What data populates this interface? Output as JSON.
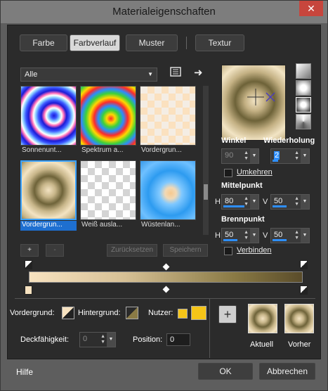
{
  "window": {
    "title": "Materialeigenschaften"
  },
  "tabs": [
    {
      "label": "Farbe"
    },
    {
      "label": "Farbverlauf"
    },
    {
      "label": "Muster"
    },
    {
      "label": "Textur"
    }
  ],
  "category": {
    "value": "Alle"
  },
  "gallery": [
    {
      "label": "Sonnenunt..."
    },
    {
      "label": "Spektrum a..."
    },
    {
      "label": "Vordergrun..."
    },
    {
      "label": "Vordergrun..."
    },
    {
      "label": "Weiß ausla..."
    },
    {
      "label": "Wüstenlan..."
    }
  ],
  "gallery_selected": 3,
  "gallery_buttons": {
    "add": "+",
    "remove": "-",
    "reset": "Zurücksetzen",
    "save": "Speichern"
  },
  "props": {
    "angle_label": "Winkel",
    "angle_value": "90",
    "repeat_label": "Wiederholung",
    "repeat_value": "2",
    "invert_label": "Umkehren",
    "center_label": "Mittelpunkt",
    "center_h": "80",
    "center_v": "50",
    "focus_label": "Brennpunkt",
    "focus_h": "50",
    "focus_v": "50",
    "link_label": "Verbinden",
    "h": "H",
    "v": "V"
  },
  "lower": {
    "fg_label": "Vordergrund:",
    "bg_label": "Hintergrund:",
    "user_label": "Nutzer:",
    "opacity_label": "Deckfähigkeit:",
    "opacity_value": "0",
    "position_label": "Position:",
    "position_value": "0",
    "current_label": "Aktuell",
    "previous_label": "Vorher",
    "add": "+"
  },
  "footer": {
    "help": "Hilfe",
    "ok": "OK",
    "cancel": "Abbrechen"
  },
  "colors": {
    "accent": "#2e8fff",
    "user_swatch": "#f5c518",
    "gradient_light": "#f7e2c0",
    "gradient_dark": "#5a4c2a"
  }
}
